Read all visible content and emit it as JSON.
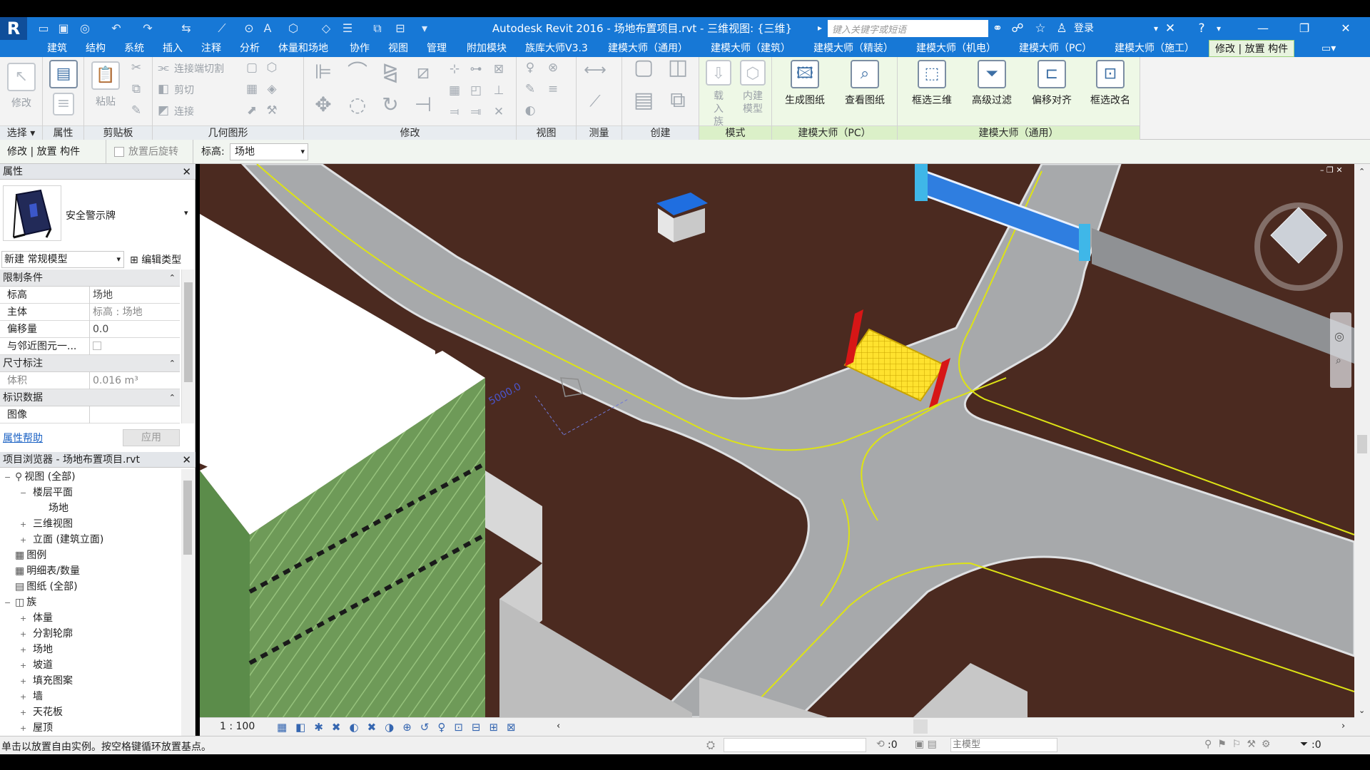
{
  "title": {
    "app_title": "Autodesk Revit 2016 -    场地布置项目.rvt - 三维视图: {三维}",
    "search_placeholder": "键入关键字或短语",
    "login_label": "登录",
    "logo_letter": "R"
  },
  "tabs": [
    "建筑",
    "结构",
    "系统",
    "插入",
    "注释",
    "分析",
    "体量和场地",
    "协作",
    "视图",
    "管理",
    "附加模块",
    "族库大师V3.3",
    "建模大师（通用）",
    "建模大师（建筑）",
    "建模大师（精装）",
    "建模大师（机电）",
    "建模大师（PC）",
    "建模大师（施工）",
    "修改 | 放置 构件"
  ],
  "ribbon": {
    "modify_label": "修改",
    "select_panel": "选择",
    "properties_panel": "属性",
    "clipboard_panel": "剪贴板",
    "paste_label": "粘贴",
    "geometry_panel": "几何图形",
    "cut_join": "连接端切割",
    "cut": "剪切",
    "join": "连接",
    "modify_panel": "修改",
    "view_panel": "视图",
    "measure_panel": "测量",
    "create_panel": "创建",
    "mode_panel": "模式",
    "load_family": "载入族",
    "inplace_model": "内建模型",
    "pc_panel": "建模大师（PC）",
    "generate_drawing": "生成图纸",
    "view_drawing": "查看图纸",
    "general_panel": "建模大师（通用）",
    "box_3d": "框选三维",
    "adv_filter": "高级过滤",
    "offset_align": "偏移对齐",
    "box_rename": "框选改名"
  },
  "optbar": {
    "context": "修改 | 放置 构件",
    "rotate_after": "放置后旋转",
    "level_label": "标高:",
    "level_value": "场地"
  },
  "properties": {
    "header": "属性",
    "type_name": "安全警示牌",
    "new_type": "新建 常规模型",
    "edit_type": "编辑类型",
    "constraints": "限制条件",
    "rows1": [
      {
        "k": "标高",
        "v": "场地"
      },
      {
        "k": "主体",
        "v": "标高 : 场地"
      },
      {
        "k": "偏移量",
        "v": "0.0"
      },
      {
        "k": "与邻近图元一...",
        "v": ""
      }
    ],
    "dimensions": "尺寸标注",
    "volume_k": "体积",
    "volume_v": "0.016 m³",
    "identity": "标识数据",
    "image_k": "图像",
    "help": "属性帮助",
    "apply": "应用"
  },
  "browser": {
    "header": "项目浏览器 - 场地布置项目.rvt",
    "items": [
      {
        "t": "视图 (全部)",
        "x": 0,
        "e": "−",
        "ic": "⚲"
      },
      {
        "t": "楼层平面",
        "x": 1,
        "e": "−",
        "ic": ""
      },
      {
        "t": "场地",
        "x": 2,
        "e": "",
        "ic": ""
      },
      {
        "t": "三维视图",
        "x": 1,
        "e": "+",
        "ic": ""
      },
      {
        "t": "立面 (建筑立面)",
        "x": 1,
        "e": "+",
        "ic": ""
      },
      {
        "t": "图例",
        "x": 0,
        "e": "",
        "ic": "▦"
      },
      {
        "t": "明细表/数量",
        "x": 0,
        "e": "",
        "ic": "▦"
      },
      {
        "t": "图纸 (全部)",
        "x": 0,
        "e": "",
        "ic": "▤"
      },
      {
        "t": "族",
        "x": 0,
        "e": "−",
        "ic": "◫"
      },
      {
        "t": "体量",
        "x": 1,
        "e": "+",
        "ic": ""
      },
      {
        "t": "分割轮廓",
        "x": 1,
        "e": "+",
        "ic": ""
      },
      {
        "t": "场地",
        "x": 1,
        "e": "+",
        "ic": ""
      },
      {
        "t": "坡道",
        "x": 1,
        "e": "+",
        "ic": ""
      },
      {
        "t": "填充图案",
        "x": 1,
        "e": "+",
        "ic": ""
      },
      {
        "t": "墙",
        "x": 1,
        "e": "+",
        "ic": ""
      },
      {
        "t": "天花板",
        "x": 1,
        "e": "+",
        "ic": ""
      },
      {
        "t": "屋顶",
        "x": 1,
        "e": "+",
        "ic": ""
      }
    ]
  },
  "viewport": {
    "dimension_label": "5000.0",
    "scale": "1 : 100"
  },
  "status": {
    "message": "单击以放置自由实例。按空格键循环放置基点。",
    "count": ":0",
    "model": "主模型",
    "filter": ":0"
  },
  "colors": {
    "title_blue": "#1778d6",
    "ground": "#4b2a20",
    "road": "#a7a9ab",
    "fence": "#6d9a5a",
    "gate": "#2f7ee0",
    "pad": "#ffe52b",
    "pad_edge": "#d71616",
    "lane_line": "#d6dd1c"
  }
}
